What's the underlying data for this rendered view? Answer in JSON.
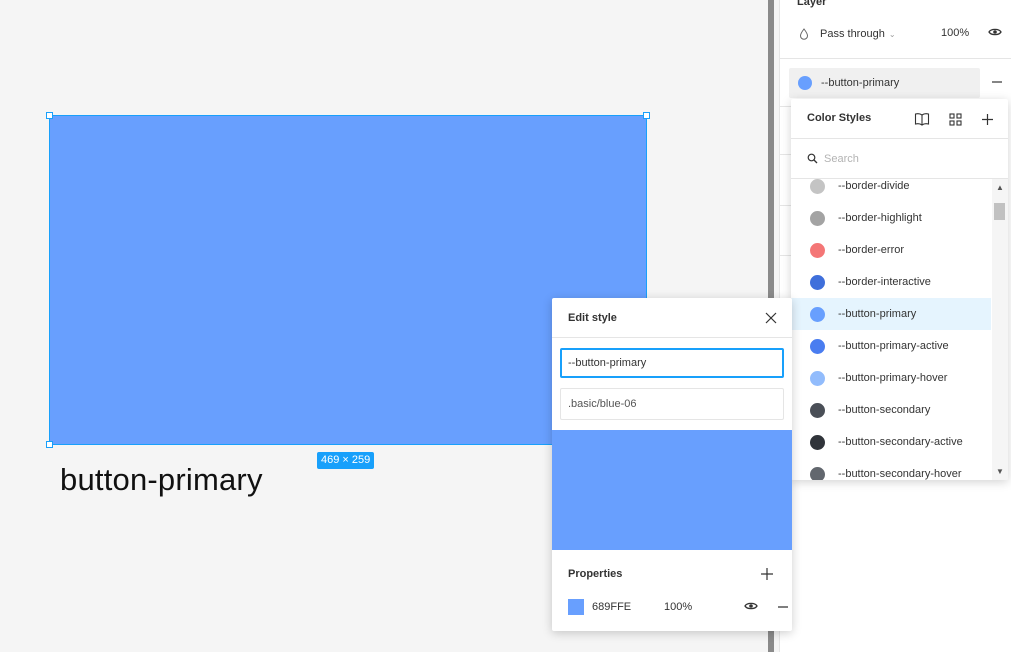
{
  "canvas": {
    "frame_label": "button-primary",
    "dimensions": "469 × 259"
  },
  "layer": {
    "title": "Layer",
    "blend_mode": "Pass through",
    "opacity": "100%"
  },
  "fill": {
    "style_name": "--button-primary",
    "color": "#689ffe"
  },
  "color_styles": {
    "title": "Color Styles",
    "search_placeholder": "Search",
    "items": [
      {
        "label": "--border-divide",
        "color": "#c4c4c4"
      },
      {
        "label": "--border-highlight",
        "color": "#a3a3a3"
      },
      {
        "label": "--border-error",
        "color": "#f47676"
      },
      {
        "label": "--border-interactive",
        "color": "#3f6fdb"
      },
      {
        "label": "--button-primary",
        "color": "#689ffe",
        "active": true
      },
      {
        "label": "--button-primary-active",
        "color": "#4a7df0"
      },
      {
        "label": "--button-primary-hover",
        "color": "#92bcfc"
      },
      {
        "label": "--button-secondary",
        "color": "#4a4f57"
      },
      {
        "label": "--button-secondary-active",
        "color": "#30343a"
      },
      {
        "label": "--button-secondary-hover",
        "color": "#62676e"
      }
    ]
  },
  "edit_style": {
    "title": "Edit style",
    "name_value": "--button-primary",
    "description_value": ".basic/blue-06",
    "preview_color": "#689ffe",
    "properties_title": "Properties",
    "property": {
      "hex": "689FFE",
      "opacity": "100%",
      "color": "#689ffe"
    }
  }
}
